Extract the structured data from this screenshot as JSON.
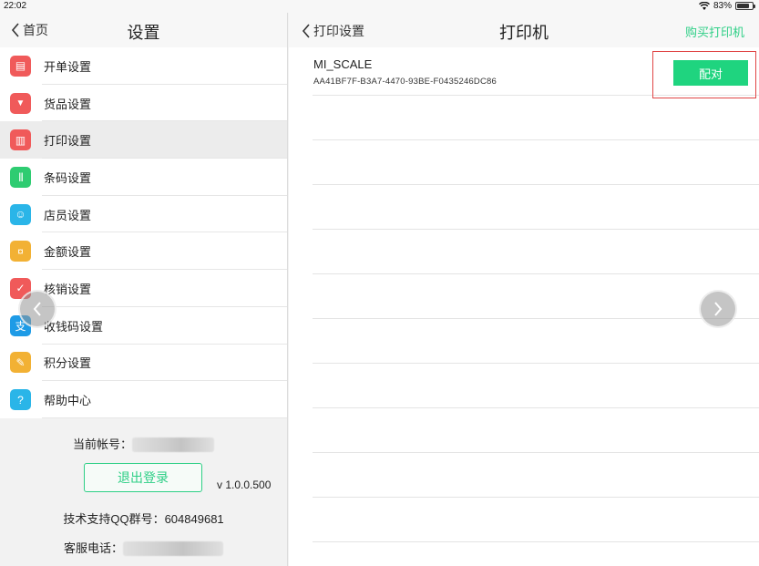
{
  "status_bar": {
    "time": "22:02",
    "battery": "83%",
    "battery_level": 0.83
  },
  "left_panel": {
    "back_label": "首页",
    "title": "设置",
    "menu": [
      {
        "label": "开单设置",
        "icon": "clipboard-icon",
        "color": "#f05a5a"
      },
      {
        "label": "货品设置",
        "icon": "shirt-icon",
        "color": "#f05a5a"
      },
      {
        "label": "打印设置",
        "icon": "printer-icon",
        "color": "#f05a5a",
        "active": true
      },
      {
        "label": "条码设置",
        "icon": "barcode-icon",
        "color": "#2ecc71"
      },
      {
        "label": "店员设置",
        "icon": "staff-icon",
        "color": "#2ab5e8"
      },
      {
        "label": "金额设置",
        "icon": "money-bag-icon",
        "color": "#f2b134"
      },
      {
        "label": "核销设置",
        "icon": "verify-icon",
        "color": "#f05a5a"
      },
      {
        "label": "收钱码设置",
        "icon": "alipay-icon",
        "color": "#1e9be6"
      },
      {
        "label": "积分设置",
        "icon": "points-icon",
        "color": "#f2b134"
      },
      {
        "label": "帮助中心",
        "icon": "help-icon",
        "color": "#2ab5e8"
      }
    ],
    "account_label": "当前帐号：",
    "logout_label": "退出登录",
    "version": "v 1.0.0.500",
    "qq_label": "技术支持QQ群号：",
    "qq_value": "604849681",
    "phone_label": "客服电话："
  },
  "right_panel": {
    "back_label": "打印设置",
    "title": "打印机",
    "buy_label": "购买打印机",
    "printer_name": "MI_SCALE",
    "printer_id": "AA41BF7F-B3A7-4470-93BE-F0435246DC86",
    "pair_label": "配对"
  },
  "colors": {
    "accent": "#2ecf86",
    "pair_button": "#1fd47f",
    "highlight": "#e04545"
  }
}
